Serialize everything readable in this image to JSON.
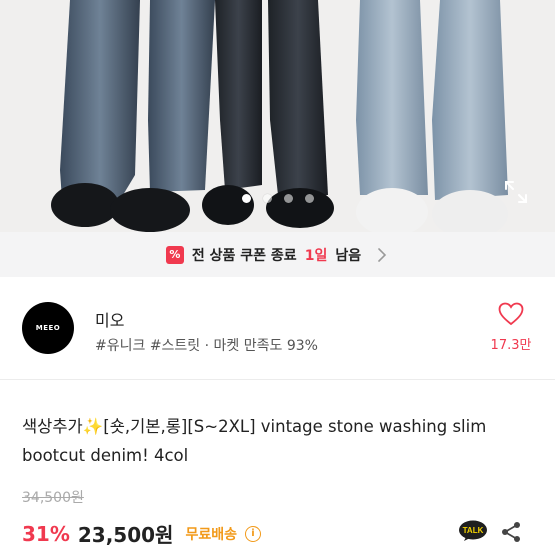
{
  "coupon": {
    "icon_glyph": "%",
    "text": "전 상품 쿠폰 종료",
    "days": "1일",
    "rest": "남음"
  },
  "seller": {
    "avatar_text": "MEEO",
    "name": "미오",
    "tags": "#유니크 #스트릿 · 마켓 만족도 93%",
    "likes": "17.3만"
  },
  "product": {
    "title": "색상추가✨[숏,기본,롱][S~2XL] vintage stone washing slim bootcut denim! 4col",
    "original_price": "34,500원",
    "discount": "31%",
    "price": "23,500원",
    "shipping": "무료배송",
    "info_glyph": "i"
  },
  "carousel": {
    "count": 4,
    "active": 0
  },
  "colors": {
    "accent": "#f0394f",
    "shipping": "#f29a1a"
  },
  "icons": [
    "expand-icon",
    "coupon-icon",
    "chevron-right-icon",
    "heart-icon",
    "info-icon",
    "kakaotalk-icon",
    "share-icon"
  ]
}
